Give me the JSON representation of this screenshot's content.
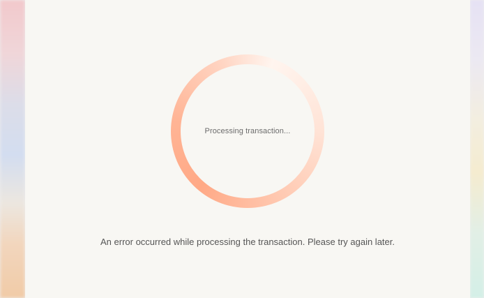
{
  "spinner": {
    "status_text": "Processing transaction...",
    "gradient_colors": [
      "#fff5ef",
      "#ffc6ad",
      "#ffa986"
    ]
  },
  "message": {
    "error_text": "An error occurred while processing the transaction. Please try again later."
  },
  "colors": {
    "card_background": "#f8f7f3",
    "text_primary": "#555555",
    "text_secondary": "#6b6b6b"
  }
}
